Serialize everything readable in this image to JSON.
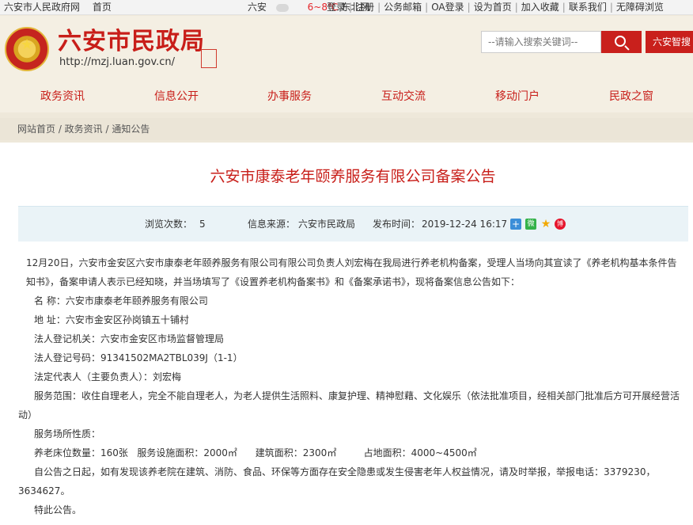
{
  "topbar": {
    "gov_name": "六安市人民政府网",
    "home": "首页",
    "city": "六安",
    "temp": "6~8℃",
    "wind": "东北风",
    "links": [
      "登录",
      "注册",
      "公务邮箱",
      "OA登录",
      "设为首页",
      "加入收藏",
      "联系我们",
      "无障碍浏览"
    ]
  },
  "header": {
    "title": "六安市民政局",
    "url": "http://mzj.luan.gov.cn/",
    "seal_text": "六安民政",
    "search_placeholder": "--请输入搜索关键词--",
    "smart_label": "六安智搜"
  },
  "nav": [
    "政务资讯",
    "信息公开",
    "办事服务",
    "互动交流",
    "移动门户",
    "民政之窗"
  ],
  "breadcrumb": "网站首页 / 政务资讯 / 通知公告",
  "article": {
    "title": "六安市康泰老年颐养服务有限公司备案公告",
    "views_label": "浏览次数：",
    "views": "5",
    "source_label": "信息来源：",
    "source": "六安市民政局",
    "time_label": "发布时间：",
    "time": "2019-12-24 16:17",
    "paragraphs": [
      "12月20日，六安市金安区六安市康泰老年颐养服务有限公司有限公司负责人刘宏梅在我局进行养老机构备案，受理人当场向其宣读了《养老机构基本条件告知书》，备案申请人表示已经知晓，并当场填写了《设置养老机构备案书》和《备案承诺书》，现将备案信息公告如下：",
      "名  称：六安市康泰老年颐养服务有限公司",
      "地  址：六安市金安区孙岗镇五十铺村",
      "法人登记机关：六安市金安区市场监督管理局",
      "法人登记号码：91341502MA2TBL039J（1-1）",
      "法定代表人（主要负责人）：刘宏梅",
      "服务范围：收住自理老人，完全不能自理老人，为老人提供生活照料、康复护理、精神慰藉、文化娱乐（依法批准项目，经相关部门批准后方可开展经营活动）",
      "服务场所性质：",
      "养老床位数量：160张   服务设施面积：2000㎡      建筑面积：2300㎡         占地面积：4000~4500㎡",
      "自公告之日起，如有发现该养老院在建筑、消防、食品、环保等方面存在安全隐患或发生侵害老年人权益情况，请及时举报，举报电话：3379230，3634627。",
      "特此公告。"
    ]
  },
  "colors": {
    "brand_red": "#c81e19",
    "meta_bg": "#eaf3f7"
  }
}
